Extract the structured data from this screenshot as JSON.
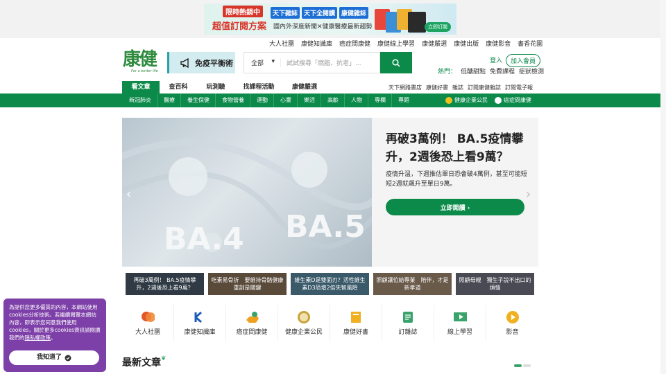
{
  "ad": {
    "tag": "限時熱銷中",
    "main": "超值訂閱方案",
    "mags": [
      "天下雜誌",
      "天下全閱讀",
      "康健雜誌"
    ],
    "sub": "國內外深度新聞✕健康醫療最新趨勢",
    "button": "立即訂閱"
  },
  "toplinks": [
    "大人社團",
    "康健知識庫",
    "癌症問康健",
    "康健線上學習",
    "康健嚴選",
    "康健出版",
    "康健影音",
    "書香花園"
  ],
  "logo": {
    "text": "康健",
    "slogan": "For a better life"
  },
  "promo": {
    "label": "免疫平衡術"
  },
  "search": {
    "category": "全部",
    "placeholder": "試試搜尋「燃脂、抗老」..."
  },
  "auth": {
    "login": "登入",
    "join": "加入會員"
  },
  "hot": {
    "label": "熱門：",
    "items": [
      "低醣甜點",
      "免費課程",
      "症狀檢測"
    ]
  },
  "nav1": {
    "items": [
      "看文章",
      "查百科",
      "玩測驗",
      "找課程活動",
      "康健嚴選"
    ],
    "right": [
      "天下網路書店",
      "康健好書",
      "雜誌",
      "訂閱康健雜誌",
      "訂閱電子報"
    ]
  },
  "nav2": {
    "items": [
      "新冠肺炎",
      "醫療",
      "養生保健",
      "食物營養",
      "運動",
      "心靈",
      "樂活",
      "高齡",
      "人物",
      "專欄",
      "專題"
    ],
    "right": [
      "健康企業公民",
      "癌症問康健"
    ]
  },
  "hero": {
    "image_text": [
      "BA.4",
      "BA.5"
    ],
    "title": "再破3萬例！ BA.5疫情攀升，2週後恐上看9萬？",
    "desc": "疫情升溫，下週推估單日恐會破4萬例，甚至可能短短2週就飆升至單日9萬。",
    "button": "立即閱讀 ›"
  },
  "thumbs": [
    {
      "text": "再破3萬例！ BA.5疫情攀升，2週後恐上看9萬？",
      "color": "#2f3a45"
    },
    {
      "text": "吃素易骨折　要維持骨骼健康重訓是關鍵",
      "color": "#5a4a3a"
    },
    {
      "text": "維生素D是雙面刃？活性維生素D3恐增2倍失智風險",
      "color": "#3a5a6a"
    },
    {
      "text": "照顧讓位給專業　陪伴，才是新孝道",
      "color": "#6a5a4a"
    },
    {
      "text": "照顧母親　獨生子說不出口的煩惱",
      "color": "#4a4a55"
    }
  ],
  "shortcuts": [
    {
      "label": "大人社團",
      "icon": "chat-bubbles-icon",
      "color": "#e2572b"
    },
    {
      "label": "康健知識庫",
      "icon": "k-logo-icon",
      "color": "#1d5fb8"
    },
    {
      "label": "癌症問康健",
      "icon": "hands-icon",
      "color": "#f0a020"
    },
    {
      "label": "健康企業公民",
      "icon": "or-badge-icon",
      "color": "#c9a43a"
    },
    {
      "label": "康健好書",
      "icon": "book-icon",
      "color": "#f0b020"
    },
    {
      "label": "訂雜誌",
      "icon": "magazine-icon",
      "color": "#3aa36c"
    },
    {
      "label": "線上學習",
      "icon": "video-screen-icon",
      "color": "#3aa36c"
    },
    {
      "label": "影音",
      "icon": "play-icon",
      "color": "#f0b020"
    }
  ],
  "latest": {
    "title": "最新文章"
  },
  "cookie": {
    "text": "為提供您更多優質的內容，本網站使用cookies分析技術。若繼續閱覽本網站內容，即表示您同意我們使用cookies，關於更多cookies資訊請閱讀我們的",
    "link": "隱私權政策",
    "end": "。",
    "button": "我知道了"
  }
}
